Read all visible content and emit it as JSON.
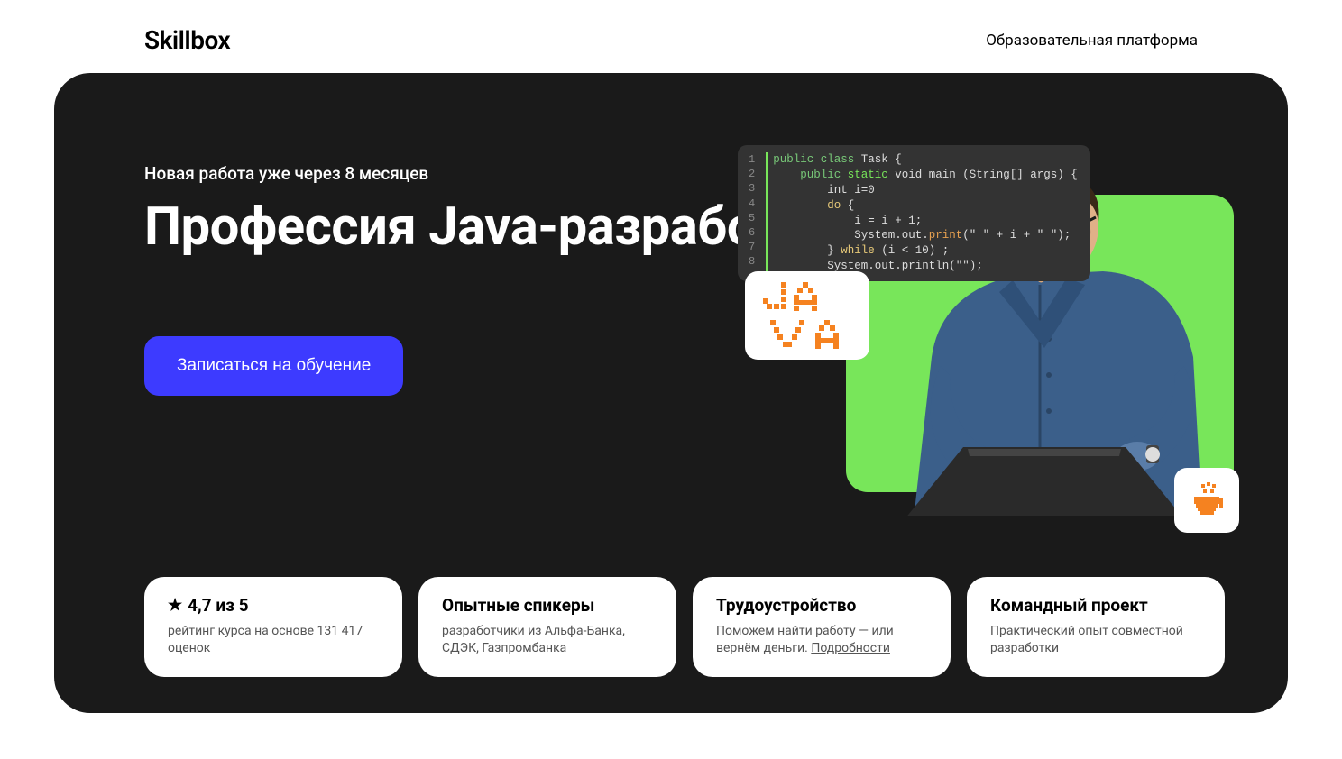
{
  "header": {
    "logo": "Skillbox",
    "tagline": "Образовательная платформа"
  },
  "hero": {
    "eyebrow": "Новая работа уже через 8 месяцев",
    "title": "Профессия Java-разработчик",
    "cta": "Записаться на обучение",
    "java_badge": "JAVA",
    "code": {
      "line_numbers": [
        "1",
        "2",
        "3",
        "4",
        "5",
        "6",
        "7",
        "8"
      ],
      "lines": [
        {
          "indent": 0,
          "tokens": [
            {
              "t": "public ",
              "c": "kw-pub"
            },
            {
              "t": "class ",
              "c": "kw-pub"
            },
            {
              "t": "Task {",
              "c": ""
            }
          ]
        },
        {
          "indent": 1,
          "tokens": [
            {
              "t": "public ",
              "c": "kw-pub"
            },
            {
              "t": "static ",
              "c": "kw-stat"
            },
            {
              "t": "void main (String[] args) {",
              "c": ""
            }
          ]
        },
        {
          "indent": 2,
          "tokens": [
            {
              "t": "int i=0",
              "c": ""
            }
          ]
        },
        {
          "indent": 2,
          "tokens": [
            {
              "t": "do ",
              "c": "kw-do"
            },
            {
              "t": "{",
              "c": ""
            }
          ]
        },
        {
          "indent": 3,
          "tokens": [
            {
              "t": "i = i + 1;",
              "c": ""
            }
          ]
        },
        {
          "indent": 3,
          "tokens": [
            {
              "t": "System.out.",
              "c": ""
            },
            {
              "t": "print",
              "c": "kw-print"
            },
            {
              "t": "(\" \" + i + \" \");",
              "c": ""
            }
          ]
        },
        {
          "indent": 2,
          "tokens": [
            {
              "t": "} ",
              "c": ""
            },
            {
              "t": "while ",
              "c": "kw-do"
            },
            {
              "t": "(i < 10) ;",
              "c": ""
            }
          ]
        },
        {
          "indent": 2,
          "tokens": [
            {
              "t": "System.out.println(\"\");",
              "c": ""
            }
          ]
        }
      ]
    }
  },
  "cards": [
    {
      "icon": "star",
      "title": "4,7 из 5",
      "desc": "рейтинг курса на основе 131 417 оценок"
    },
    {
      "title": "Опытные спикеры",
      "desc": "разработчики из Альфа-Банка, СДЭК, Газпромбанка"
    },
    {
      "title": "Трудоустройство",
      "desc": "Поможем найти работу — или вернём деньги. ",
      "link": "Подробности"
    },
    {
      "title": "Командный проект",
      "desc": "Практический опыт совместной разработки"
    }
  ]
}
